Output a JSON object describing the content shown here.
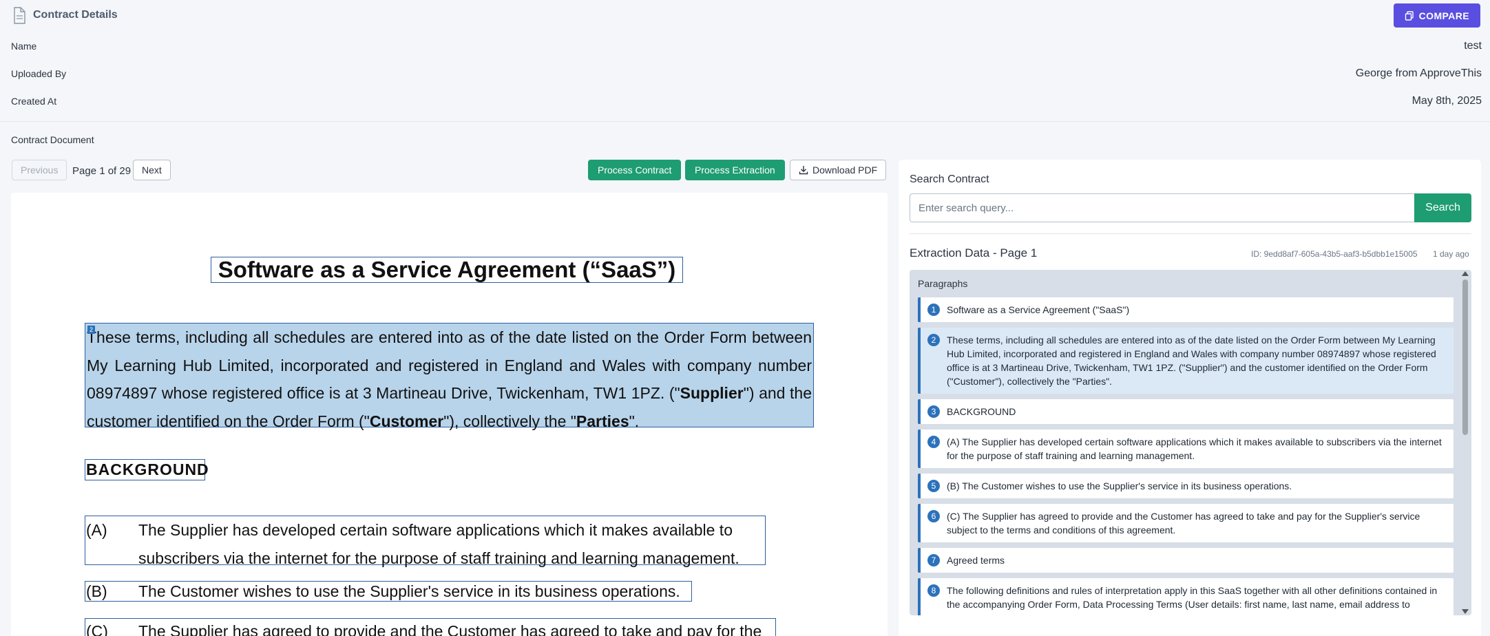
{
  "header": {
    "title": "Contract Details",
    "icon": "document-icon",
    "compare_label": "COMPARE",
    "compare_icon": "copy-icon"
  },
  "details": {
    "name_label": "Name",
    "name_value": "test",
    "uploaded_label": "Uploaded By",
    "uploaded_value": "George from ApproveThis",
    "created_label": "Created At",
    "created_value": "May 8th, 2025"
  },
  "document_section": {
    "title": "Contract Document",
    "prev_label": "Previous",
    "page_info": "Page 1 of 29",
    "next_label": "Next",
    "process_contract_label": "Process Contract",
    "process_extraction_label": "Process Extraction",
    "download_label": "Download PDF",
    "download_icon": "download-icon"
  },
  "document": {
    "title": "Software as a Service Agreement (“SaaS”)",
    "para_marker": "2",
    "para_part1": "These terms, including all schedules are entered into as of the date listed on the Order Form between My Learning Hub Limited, incorporated and registered in England and Wales with company number 08974897 whose registered office is at 3 Martineau Drive, Twickenham, TW1 1PZ.   (\"",
    "para_supplier": "Supplier",
    "para_part2": "\") and the customer identified on the Order Form (\"",
    "para_customer": "Customer",
    "para_part3": "\"), collectively the \"",
    "para_parties": "Parties",
    "para_part4": "\".",
    "background_heading": "BACKGROUND",
    "item_a_label": "(A)",
    "item_a_line1": "The Supplier has developed certain software applications which it makes available to",
    "item_a_line2": "subscribers via the internet for the purpose of staff training and learning management.",
    "item_b_label": "(B)",
    "item_b_line1": "The Customer wishes to use the Supplier's service in its business operations.",
    "item_c_label": "(C)",
    "item_c_line1": "The Supplier has agreed to provide and the Customer has agreed to take and pay for the"
  },
  "search": {
    "label": "Search Contract",
    "placeholder": "Enter search query...",
    "button_label": "Search"
  },
  "extraction": {
    "title": "Extraction Data - Page 1",
    "id_text": "ID: 9edd8af7-605a-43b5-aaf3-b5dbb1e15005",
    "age_text": "1 day ago",
    "paragraphs_label": "Paragraphs",
    "items": [
      {
        "num": "1",
        "text": "Software as a Service Agreement (\"SaaS\")"
      },
      {
        "num": "2",
        "text": "These terms, including all schedules are entered into as of the date listed on the Order Form between My Learning Hub Limited, incorporated and registered in England and Wales with company number 08974897 whose registered office is at 3 Martineau Drive, Twickenham, TW1 1PZ. (\"Supplier\") and the customer identified on the Order Form (\"Customer\"), collectively the \"Parties\"."
      },
      {
        "num": "3",
        "text": "BACKGROUND"
      },
      {
        "num": "4",
        "text": "(A) The Supplier has developed certain software applications which it makes available to subscribers via the internet for the purpose of staff training and learning management."
      },
      {
        "num": "5",
        "text": "(B) The Customer wishes to use the Supplier's service in its business operations."
      },
      {
        "num": "6",
        "text": "(C) The Supplier has agreed to provide and the Customer has agreed to take and pay for the Supplier's service subject to the terms and conditions of this agreement."
      },
      {
        "num": "7",
        "text": "Agreed terms"
      },
      {
        "num": "8",
        "text": "The following definitions and rules of interpretation apply in this SaaS together with all other definitions contained in the accompanying Order Form, Data Processing Terms (User details: first name, last name, email address to"
      }
    ]
  },
  "colors": {
    "accent_purple": "#5a4ee0",
    "action_green": "#1e9c72",
    "highlight_blue": "#2c72bb"
  }
}
